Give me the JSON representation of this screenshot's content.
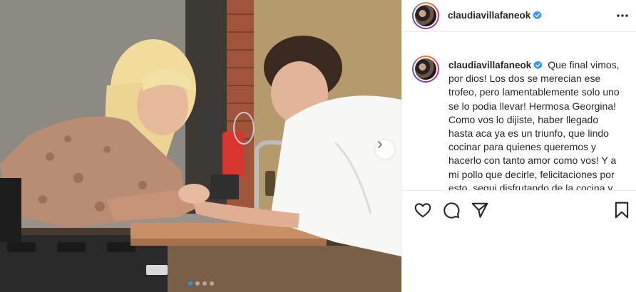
{
  "post": {
    "username": "claudiavillafaneok",
    "verified": true,
    "caption": "Que final vimos, por dios! Los dos se merecian ese trofeo, pero lamentablemente solo uno se lo podia llevar! Hermosa Georgina! Como vos lo dijiste, haber llegado hasta aca ya es un triunfo, que lindo cocinar para quienes queremos y hacerlo con tanto amor como vos! Y a mi pollo que decirle, felicitaciones por esto, segui disfrutando de la cocina y"
  },
  "carousel": {
    "total_slides": 4,
    "current_slide": 1
  },
  "icons": {
    "more": "more-horizontal-icon",
    "next": "chevron-right-icon",
    "like": "heart-icon",
    "comment": "comment-bubble-icon",
    "share": "paper-plane-icon",
    "save": "bookmark-icon",
    "verified": "verified-badge-icon"
  },
  "colors": {
    "verified_blue": "#3897f0",
    "active_dot": "#1a9bf0",
    "text": "#262626",
    "divider": "#efefef"
  }
}
